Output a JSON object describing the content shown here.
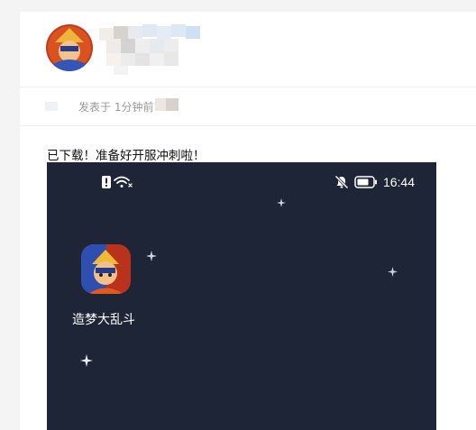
{
  "post": {
    "meta_time": "发表于 1分钟前",
    "content": "已下载！准备好开服冲刺啦！"
  },
  "screenshot": {
    "status_time": "16:44",
    "app_label": "造梦大乱斗",
    "app_icon": "game-hero-icon"
  },
  "colors": {
    "phone_bg": "#1e2536",
    "page_bg": "#f4f4f4",
    "meta_text": "#999999"
  }
}
